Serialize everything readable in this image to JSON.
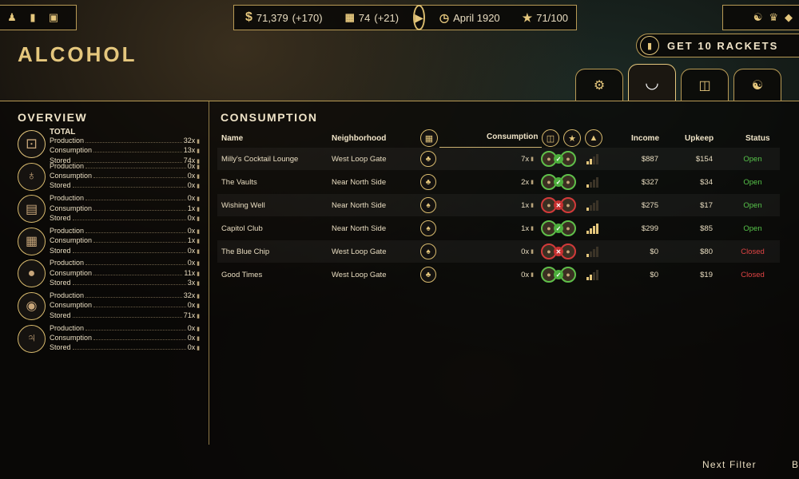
{
  "topbar": {
    "money": "71,379",
    "money_delta": "(+170)",
    "influence": "74",
    "influence_delta": "(+21)",
    "date": "April 1920",
    "heat": "71/100"
  },
  "header": {
    "title": "ALCOHOL",
    "rackets_button": "GET 10 RACKETS"
  },
  "overview": {
    "title": "OVERVIEW",
    "total_label": "TOTAL",
    "labels": {
      "production": "Production",
      "consumption": "Consumption",
      "stored": "Stored"
    },
    "items": [
      {
        "icon": "bottle-crate-icon",
        "production": "32x",
        "consumption": "13x",
        "stored": "74x"
      },
      {
        "icon": "bottle-icon",
        "production": "0x",
        "consumption": "0x",
        "stored": "0x"
      },
      {
        "icon": "crate-icon",
        "production": "0x",
        "consumption": "1x",
        "stored": "0x"
      },
      {
        "icon": "bottle-case-icon",
        "production": "0x",
        "consumption": "1x",
        "stored": "0x"
      },
      {
        "icon": "barrel-icon",
        "production": "0x",
        "consumption": "11x",
        "stored": "3x"
      },
      {
        "icon": "keg-icon",
        "production": "32x",
        "consumption": "0x",
        "stored": "71x"
      },
      {
        "icon": "jug-icon",
        "production": "0x",
        "consumption": "0x",
        "stored": "0x"
      }
    ]
  },
  "consumption": {
    "title": "CONSUMPTION",
    "headers": {
      "name": "Name",
      "neighborhood": "Neighborhood",
      "consumption": "Consumption",
      "income": "Income",
      "upkeep": "Upkeep",
      "status": "Status"
    },
    "rows": [
      {
        "name": "Milly's Cocktail Lounge",
        "neighborhood": "West Loop Gate",
        "consumption": "7x",
        "supply_ok": true,
        "level": 2,
        "income": "$887",
        "upkeep": "$154",
        "status": "Open"
      },
      {
        "name": "The Vaults",
        "neighborhood": "Near North Side",
        "consumption": "2x",
        "supply_ok": true,
        "level": 1,
        "income": "$327",
        "upkeep": "$34",
        "status": "Open"
      },
      {
        "name": "Wishing Well",
        "neighborhood": "Near North Side",
        "consumption": "1x",
        "supply_ok": false,
        "level": 1,
        "income": "$275",
        "upkeep": "$17",
        "status": "Open"
      },
      {
        "name": "Capitol Club",
        "neighborhood": "Near North Side",
        "consumption": "1x",
        "supply_ok": true,
        "level": 4,
        "income": "$299",
        "upkeep": "$85",
        "status": "Open"
      },
      {
        "name": "The Blue Chip",
        "neighborhood": "West Loop Gate",
        "consumption": "0x",
        "supply_ok": false,
        "level": 1,
        "income": "$0",
        "upkeep": "$80",
        "status": "Closed"
      },
      {
        "name": "Good Times",
        "neighborhood": "West Loop Gate",
        "consumption": "0x",
        "supply_ok": true,
        "level": 2,
        "income": "$0",
        "upkeep": "$19",
        "status": "Closed"
      }
    ]
  },
  "footer": {
    "next_filter": "Next Filter",
    "back_fragment": "B"
  },
  "colors": {
    "accent_gold": "#e5c77d",
    "status_open": "#57c44a",
    "status_closed": "#e04444"
  }
}
